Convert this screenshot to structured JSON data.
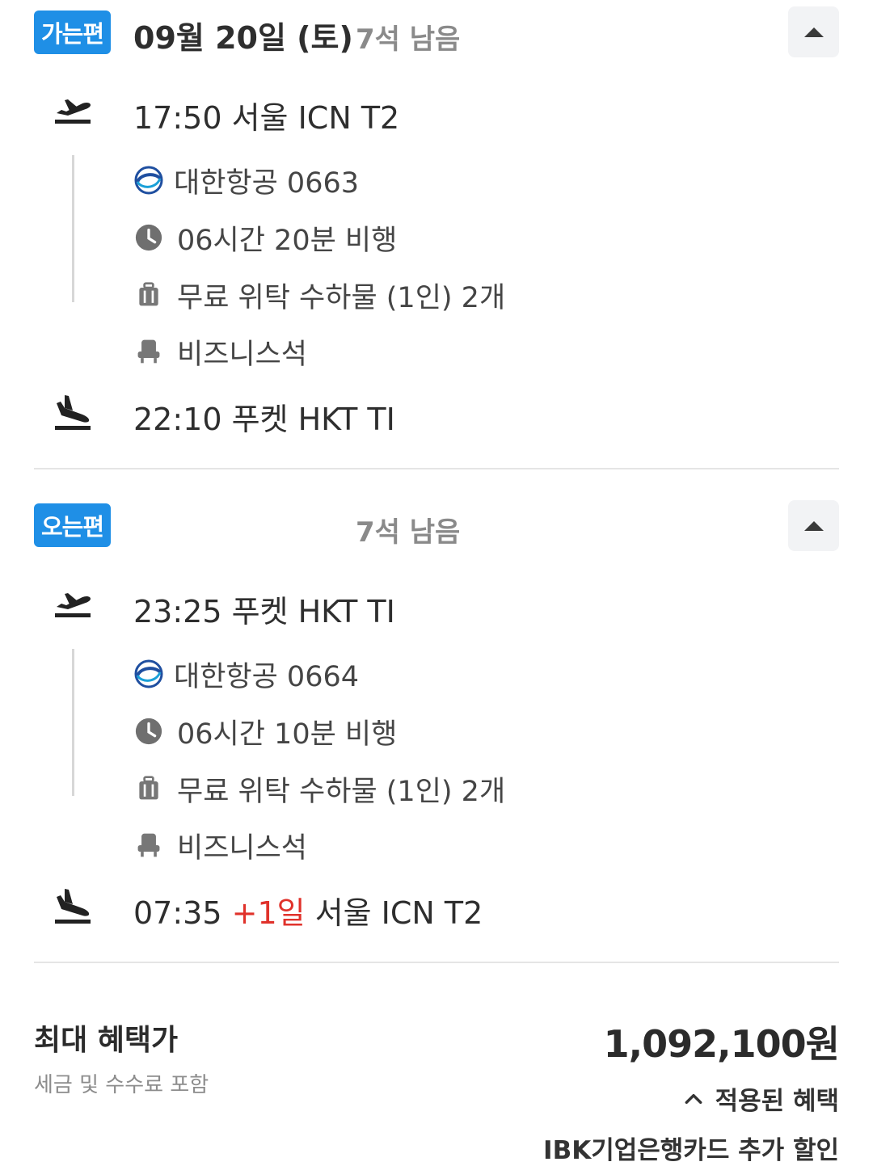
{
  "outbound": {
    "badge": "가는편",
    "date": "09월 20일 (토)",
    "seats": "7석 남음",
    "departure": "17:50 서울 ICN T2",
    "airline": "대한항공 0663",
    "duration": "06시간 20분 비행",
    "baggage": "무료 위탁 수하물 (1인) 2개",
    "cabin": "비즈니스석",
    "arrival": "22:10 푸켓 HKT TI"
  },
  "inbound": {
    "badge": "오는편",
    "seats": "7석 남음",
    "departure": "23:25 푸켓 HKT TI",
    "airline": "대한항공 0664",
    "duration": "06시간 10분 비행",
    "baggage": "무료 위탁 수하물 (1인) 2개",
    "cabin": "비즈니스석",
    "arrival_time": "07:35",
    "arrival_plus": "+1일",
    "arrival_place": "서울 ICN T2"
  },
  "price": {
    "label": "최대 혜택가",
    "sub": "세금 및 수수료 포함",
    "amount": "1,092,100원",
    "benefits_toggle": "적용된 혜택",
    "benefit_item": "IBK기업은행카드 추가 할인"
  },
  "colors": {
    "badge": "#1f8fe6",
    "accent_red": "#e0322b",
    "muted": "#8a8a8a"
  }
}
